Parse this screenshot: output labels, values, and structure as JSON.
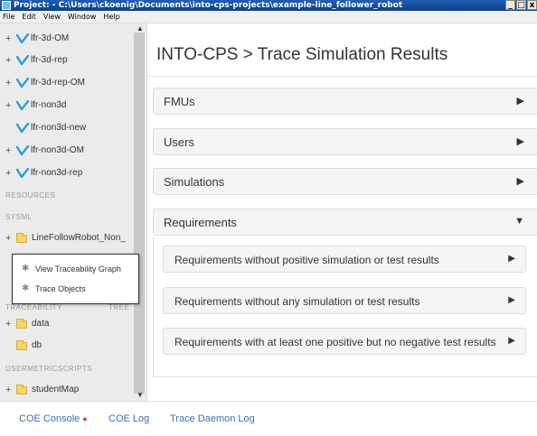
{
  "window": {
    "title": "Project: - C:\\Users\\ckoenig\\Documents\\into-cps-projects\\example-line_follower_robot",
    "controls": [
      "_",
      "□",
      "x"
    ]
  },
  "menu": [
    "File",
    "Edit",
    "View",
    "Window",
    "Help"
  ],
  "sidebar": {
    "fmu_items": [
      {
        "label": "lfr-3d-OM",
        "expandable": true
      },
      {
        "label": "lfr-3d-rep",
        "expandable": true
      },
      {
        "label": "lfr-3d-rep-OM",
        "expandable": true
      },
      {
        "label": "lfr-non3d",
        "expandable": true
      },
      {
        "label": "lfr-non3d-new",
        "expandable": false
      },
      {
        "label": "lfr-non3d-OM",
        "expandable": true
      },
      {
        "label": "lfr-non3d-rep",
        "expandable": true
      }
    ],
    "sections": {
      "resources": "RESOURCES",
      "sysml": "SYSML",
      "usermetricscripts": "USERMETRICSCRIPTS"
    },
    "sysml_item": "LineFollowRobot_Non_",
    "hidden_section": "TRACEABILITY",
    "hidden_section_right": "TREE",
    "data_item": "data",
    "db_item": "db",
    "student_item": "studentMap",
    "context_menu": {
      "view_graph": "View Traceability Graph",
      "trace_objects": "Trace Objects"
    }
  },
  "main": {
    "breadcrumb_title": "INTO-CPS > Trace Simulation Results",
    "panels": [
      {
        "label": "FMUs",
        "caret": "▶"
      },
      {
        "label": "Users",
        "caret": "▶"
      },
      {
        "label": "Simulations",
        "caret": "▶"
      },
      {
        "label": "Requirements",
        "caret": "▼"
      }
    ],
    "requirements": [
      {
        "label": "Requirements without positive simulation or test results",
        "caret": "▶"
      },
      {
        "label": "Requirements without any simulation or test results",
        "caret": "▶"
      },
      {
        "label": "Requirements with at least one positive but no negative test results",
        "caret": "▶"
      }
    ]
  },
  "footer": {
    "coe_console": "COE Console",
    "coe_status_dot": "●",
    "coe_log": "COE Log",
    "trace_daemon_log": "Trace Daemon Log"
  },
  "colors": {
    "title_bar": "#0b3f8c",
    "sidebar_bg": "#ebebeb",
    "fmu_icon": "#2a9fd8",
    "folder": "#f5d567",
    "link": "#3a6fb5",
    "status_dot": "#e0302a"
  }
}
